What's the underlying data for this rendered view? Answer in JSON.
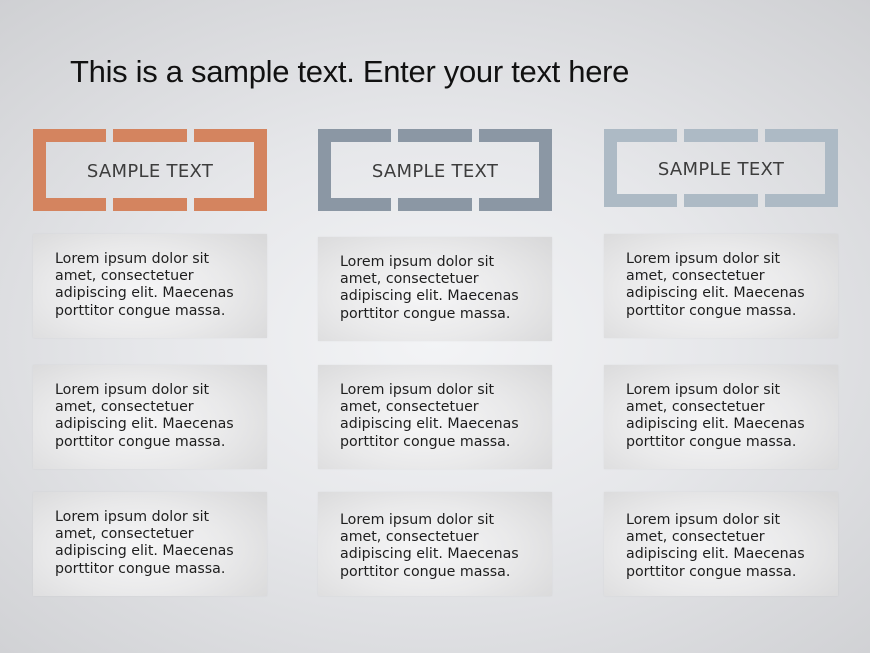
{
  "slide": {
    "title": "This is a sample text. Enter your text here"
  },
  "columns": [
    {
      "header": "SAMPLE TEXT",
      "frame_color": "#d4845f",
      "boxes": [
        {
          "lines": [
            "Lorem ipsum dolor sit",
            "amet, consectetuer",
            "adipiscing elit. Maecenas",
            "porttitor congue massa."
          ]
        },
        {
          "lines": [
            "Lorem ipsum dolor sit",
            "amet, consectetuer",
            "adipiscing elit. Maecenas",
            "porttitor congue massa."
          ]
        },
        {
          "lines": [
            "Lorem ipsum dolor sit",
            "amet, consectetuer",
            "adipiscing elit. Maecenas",
            "porttitor congue massa."
          ]
        }
      ]
    },
    {
      "header": "SAMPLE TEXT",
      "frame_color": "#8b97a4",
      "boxes": [
        {
          "lines": [
            "Lorem ipsum dolor sit",
            "amet, consectetuer",
            "adipiscing elit. Maecenas",
            "porttitor congue massa."
          ]
        },
        {
          "lines": [
            "Lorem ipsum dolor sit",
            "amet, consectetuer",
            "adipiscing elit. Maecenas",
            "porttitor congue massa."
          ]
        },
        {
          "lines": [
            "Lorem ipsum dolor sit",
            "amet, consectetuer",
            "adipiscing elit. Maecenas",
            "porttitor congue massa."
          ]
        }
      ]
    },
    {
      "header": "SAMPLE TEXT",
      "frame_color": "#adbac5",
      "boxes": [
        {
          "lines": [
            "Lorem ipsum dolor sit",
            "amet, consectetuer",
            "adipiscing elit. Maecenas",
            "porttitor congue massa."
          ]
        },
        {
          "lines": [
            "Lorem ipsum dolor sit",
            "amet, consectetuer",
            "adipiscing elit. Maecenas",
            "porttitor congue massa."
          ]
        },
        {
          "lines": [
            "Lorem ipsum dolor sit",
            "amet, consectetuer",
            "adipiscing elit. Maecenas",
            "porttitor congue massa."
          ]
        }
      ]
    }
  ]
}
